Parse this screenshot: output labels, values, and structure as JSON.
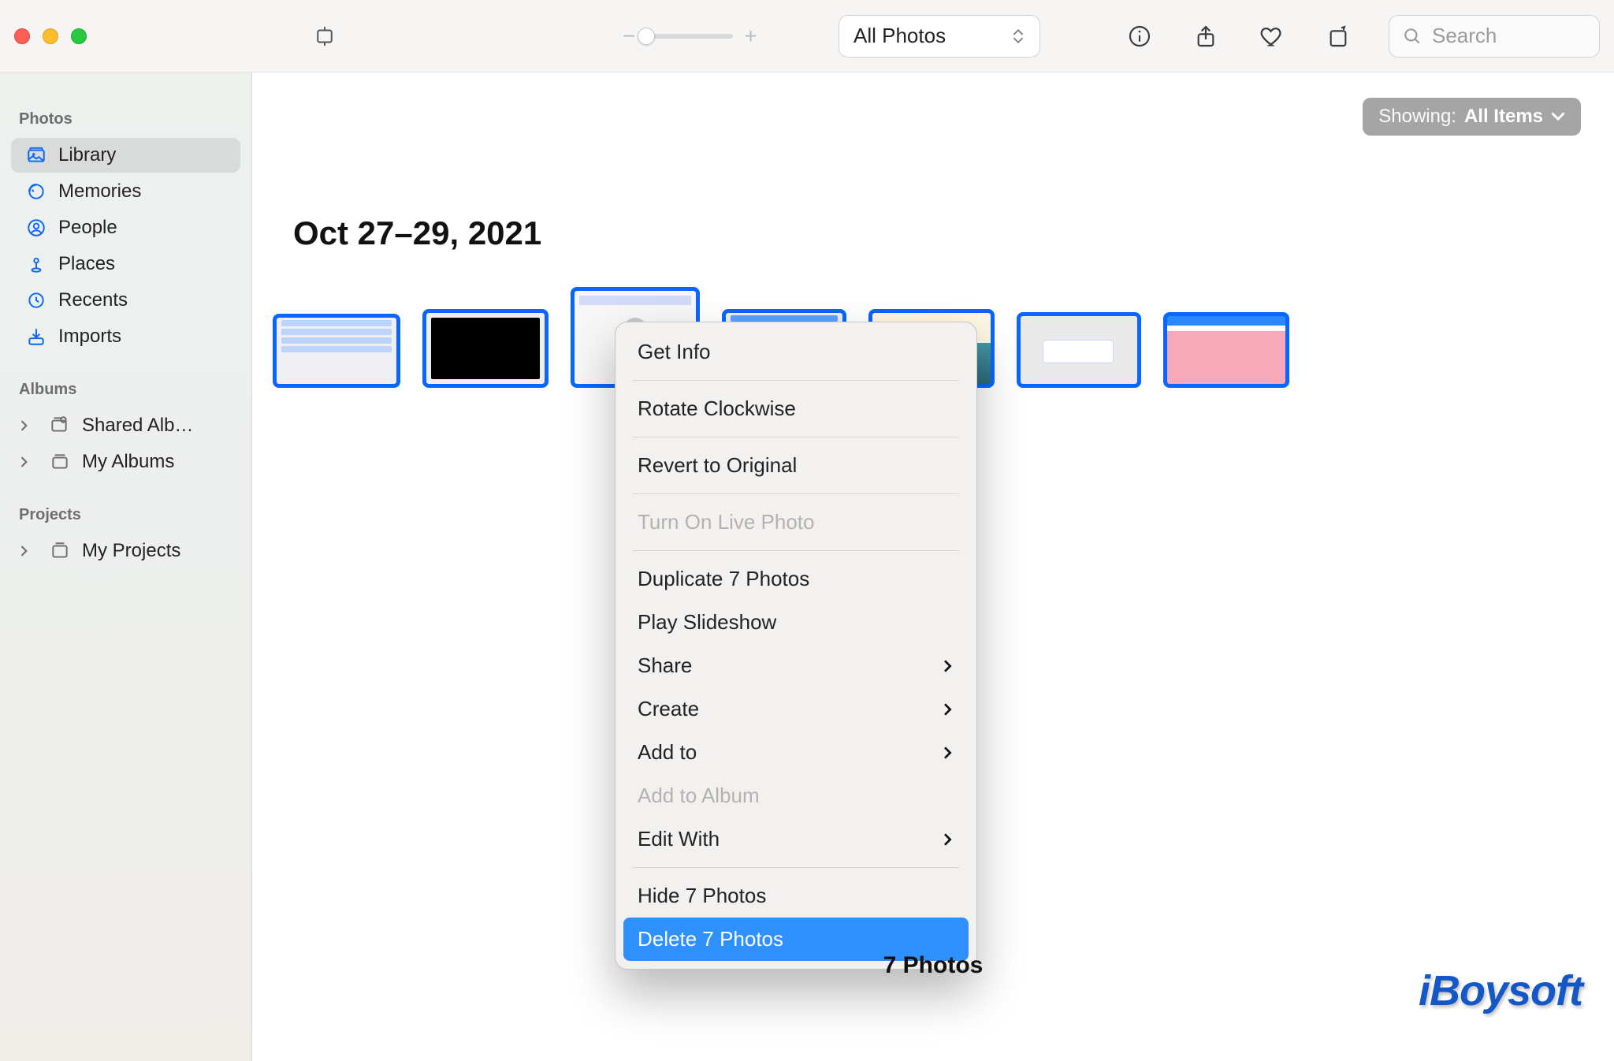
{
  "toolbar": {
    "view_menu_label": "All Photos",
    "search_placeholder": "Search"
  },
  "sidebar": {
    "sections": {
      "photos": "Photos",
      "albums": "Albums",
      "projects": "Projects"
    },
    "items": {
      "library": "Library",
      "memories": "Memories",
      "people": "People",
      "places": "Places",
      "recents": "Recents",
      "imports": "Imports",
      "shared_albums": "Shared Alb…",
      "my_albums": "My Albums",
      "my_projects": "My Projects"
    }
  },
  "main": {
    "filter_label": "Showing:",
    "filter_value": "All Items",
    "date_heading": "Oct 27–29, 2021",
    "footer_count": "7 Photos"
  },
  "context_menu": {
    "get_info": "Get Info",
    "rotate": "Rotate Clockwise",
    "revert": "Revert to Original",
    "live_photo": "Turn On Live Photo",
    "duplicate": "Duplicate 7 Photos",
    "slideshow": "Play Slideshow",
    "share": "Share",
    "create": "Create",
    "add_to": "Add to",
    "add_to_album": "Add to Album",
    "edit_with": "Edit With",
    "hide": "Hide 7 Photos",
    "delete": "Delete 7 Photos"
  },
  "watermark": "iBoysoft"
}
